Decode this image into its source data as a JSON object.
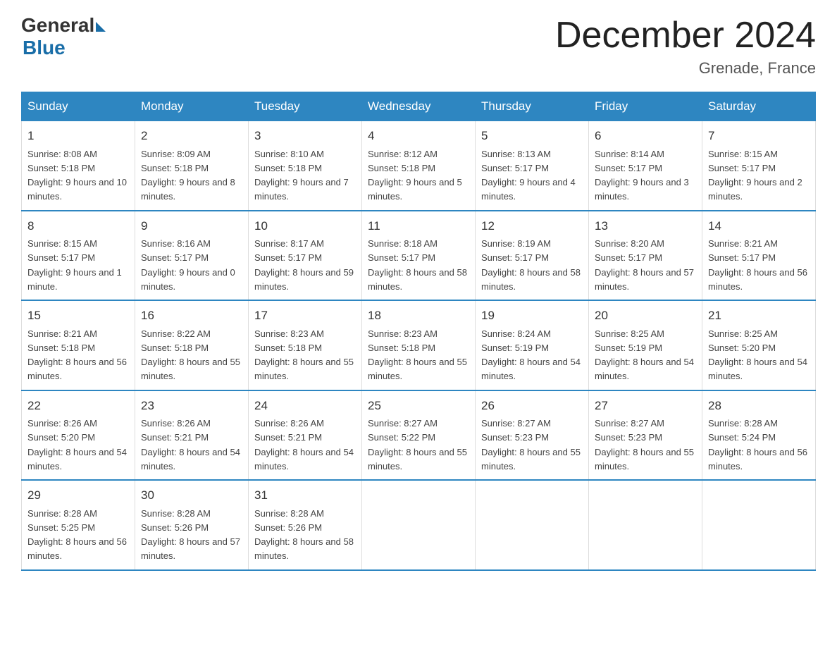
{
  "header": {
    "logo_general": "General",
    "logo_blue": "Blue",
    "title": "December 2024",
    "subtitle": "Grenade, France"
  },
  "weekdays": [
    "Sunday",
    "Monday",
    "Tuesday",
    "Wednesday",
    "Thursday",
    "Friday",
    "Saturday"
  ],
  "weeks": [
    [
      {
        "day": "1",
        "sunrise": "8:08 AM",
        "sunset": "5:18 PM",
        "daylight": "9 hours and 10 minutes."
      },
      {
        "day": "2",
        "sunrise": "8:09 AM",
        "sunset": "5:18 PM",
        "daylight": "9 hours and 8 minutes."
      },
      {
        "day": "3",
        "sunrise": "8:10 AM",
        "sunset": "5:18 PM",
        "daylight": "9 hours and 7 minutes."
      },
      {
        "day": "4",
        "sunrise": "8:12 AM",
        "sunset": "5:18 PM",
        "daylight": "9 hours and 5 minutes."
      },
      {
        "day": "5",
        "sunrise": "8:13 AM",
        "sunset": "5:17 PM",
        "daylight": "9 hours and 4 minutes."
      },
      {
        "day": "6",
        "sunrise": "8:14 AM",
        "sunset": "5:17 PM",
        "daylight": "9 hours and 3 minutes."
      },
      {
        "day": "7",
        "sunrise": "8:15 AM",
        "sunset": "5:17 PM",
        "daylight": "9 hours and 2 minutes."
      }
    ],
    [
      {
        "day": "8",
        "sunrise": "8:15 AM",
        "sunset": "5:17 PM",
        "daylight": "9 hours and 1 minute."
      },
      {
        "day": "9",
        "sunrise": "8:16 AM",
        "sunset": "5:17 PM",
        "daylight": "9 hours and 0 minutes."
      },
      {
        "day": "10",
        "sunrise": "8:17 AM",
        "sunset": "5:17 PM",
        "daylight": "8 hours and 59 minutes."
      },
      {
        "day": "11",
        "sunrise": "8:18 AM",
        "sunset": "5:17 PM",
        "daylight": "8 hours and 58 minutes."
      },
      {
        "day": "12",
        "sunrise": "8:19 AM",
        "sunset": "5:17 PM",
        "daylight": "8 hours and 58 minutes."
      },
      {
        "day": "13",
        "sunrise": "8:20 AM",
        "sunset": "5:17 PM",
        "daylight": "8 hours and 57 minutes."
      },
      {
        "day": "14",
        "sunrise": "8:21 AM",
        "sunset": "5:17 PM",
        "daylight": "8 hours and 56 minutes."
      }
    ],
    [
      {
        "day": "15",
        "sunrise": "8:21 AM",
        "sunset": "5:18 PM",
        "daylight": "8 hours and 56 minutes."
      },
      {
        "day": "16",
        "sunrise": "8:22 AM",
        "sunset": "5:18 PM",
        "daylight": "8 hours and 55 minutes."
      },
      {
        "day": "17",
        "sunrise": "8:23 AM",
        "sunset": "5:18 PM",
        "daylight": "8 hours and 55 minutes."
      },
      {
        "day": "18",
        "sunrise": "8:23 AM",
        "sunset": "5:18 PM",
        "daylight": "8 hours and 55 minutes."
      },
      {
        "day": "19",
        "sunrise": "8:24 AM",
        "sunset": "5:19 PM",
        "daylight": "8 hours and 54 minutes."
      },
      {
        "day": "20",
        "sunrise": "8:25 AM",
        "sunset": "5:19 PM",
        "daylight": "8 hours and 54 minutes."
      },
      {
        "day": "21",
        "sunrise": "8:25 AM",
        "sunset": "5:20 PM",
        "daylight": "8 hours and 54 minutes."
      }
    ],
    [
      {
        "day": "22",
        "sunrise": "8:26 AM",
        "sunset": "5:20 PM",
        "daylight": "8 hours and 54 minutes."
      },
      {
        "day": "23",
        "sunrise": "8:26 AM",
        "sunset": "5:21 PM",
        "daylight": "8 hours and 54 minutes."
      },
      {
        "day": "24",
        "sunrise": "8:26 AM",
        "sunset": "5:21 PM",
        "daylight": "8 hours and 54 minutes."
      },
      {
        "day": "25",
        "sunrise": "8:27 AM",
        "sunset": "5:22 PM",
        "daylight": "8 hours and 55 minutes."
      },
      {
        "day": "26",
        "sunrise": "8:27 AM",
        "sunset": "5:23 PM",
        "daylight": "8 hours and 55 minutes."
      },
      {
        "day": "27",
        "sunrise": "8:27 AM",
        "sunset": "5:23 PM",
        "daylight": "8 hours and 55 minutes."
      },
      {
        "day": "28",
        "sunrise": "8:28 AM",
        "sunset": "5:24 PM",
        "daylight": "8 hours and 56 minutes."
      }
    ],
    [
      {
        "day": "29",
        "sunrise": "8:28 AM",
        "sunset": "5:25 PM",
        "daylight": "8 hours and 56 minutes."
      },
      {
        "day": "30",
        "sunrise": "8:28 AM",
        "sunset": "5:26 PM",
        "daylight": "8 hours and 57 minutes."
      },
      {
        "day": "31",
        "sunrise": "8:28 AM",
        "sunset": "5:26 PM",
        "daylight": "8 hours and 58 minutes."
      },
      null,
      null,
      null,
      null
    ]
  ],
  "labels": {
    "sunrise": "Sunrise:",
    "sunset": "Sunset:",
    "daylight": "Daylight:"
  }
}
